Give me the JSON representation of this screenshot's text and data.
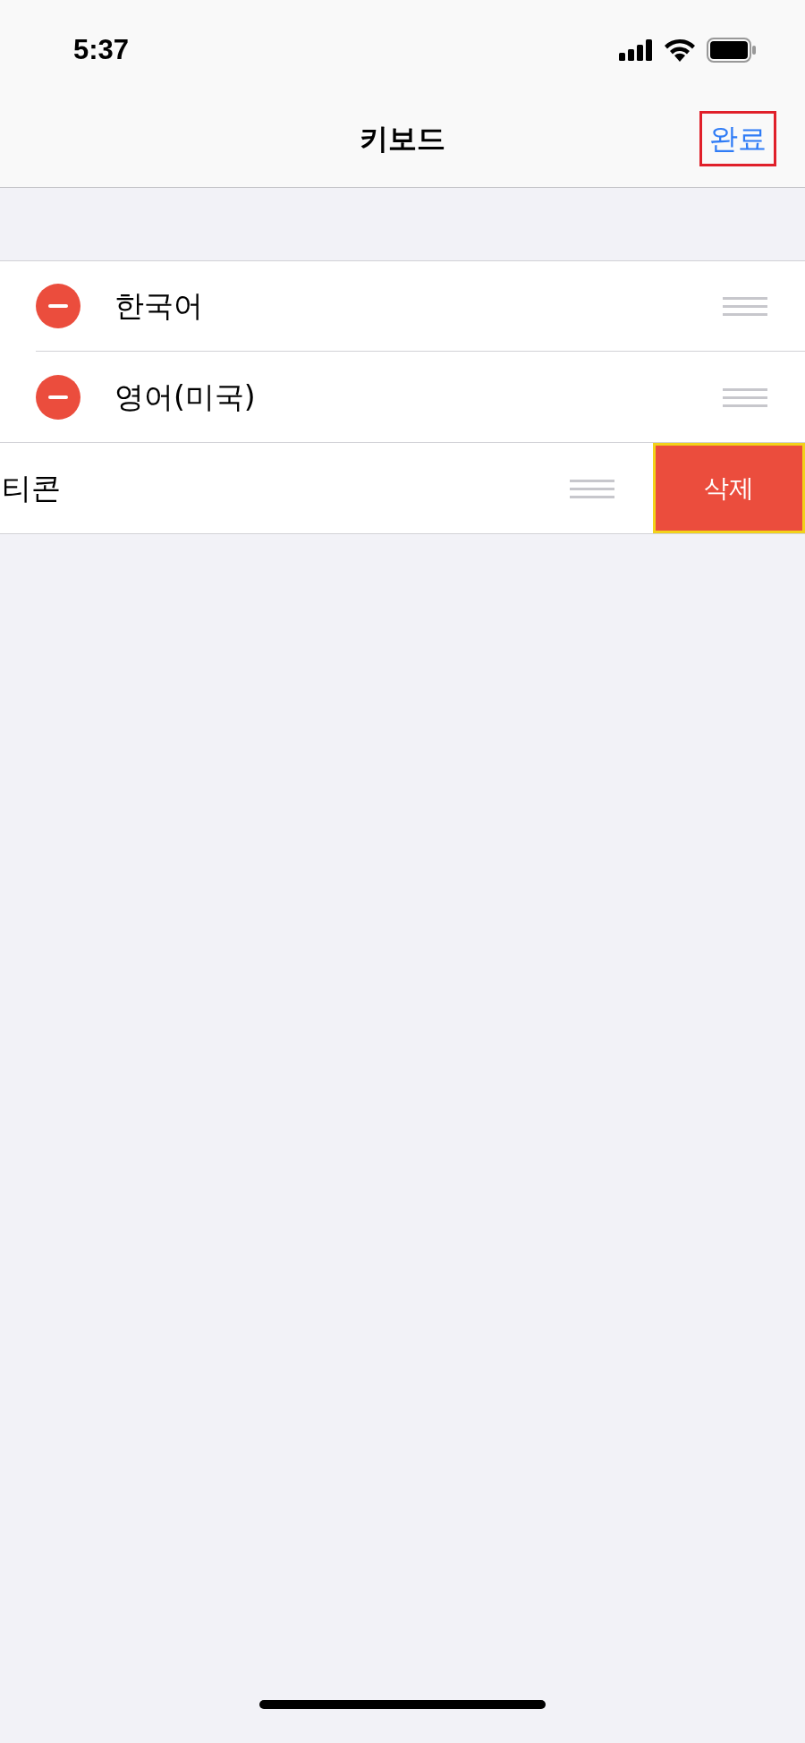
{
  "status_bar": {
    "time": "5:37"
  },
  "nav_bar": {
    "title": "키보드",
    "done_button": {
      "label": "완료",
      "highlighted": true
    }
  },
  "keyboards": [
    {
      "name": "한국어",
      "kind": "editing"
    },
    {
      "name": "영어(미국)",
      "kind": "editing"
    },
    {
      "name": "티콘",
      "kind": "swiped",
      "delete_button": {
        "label": "삭제",
        "highlighted": true
      }
    }
  ]
}
